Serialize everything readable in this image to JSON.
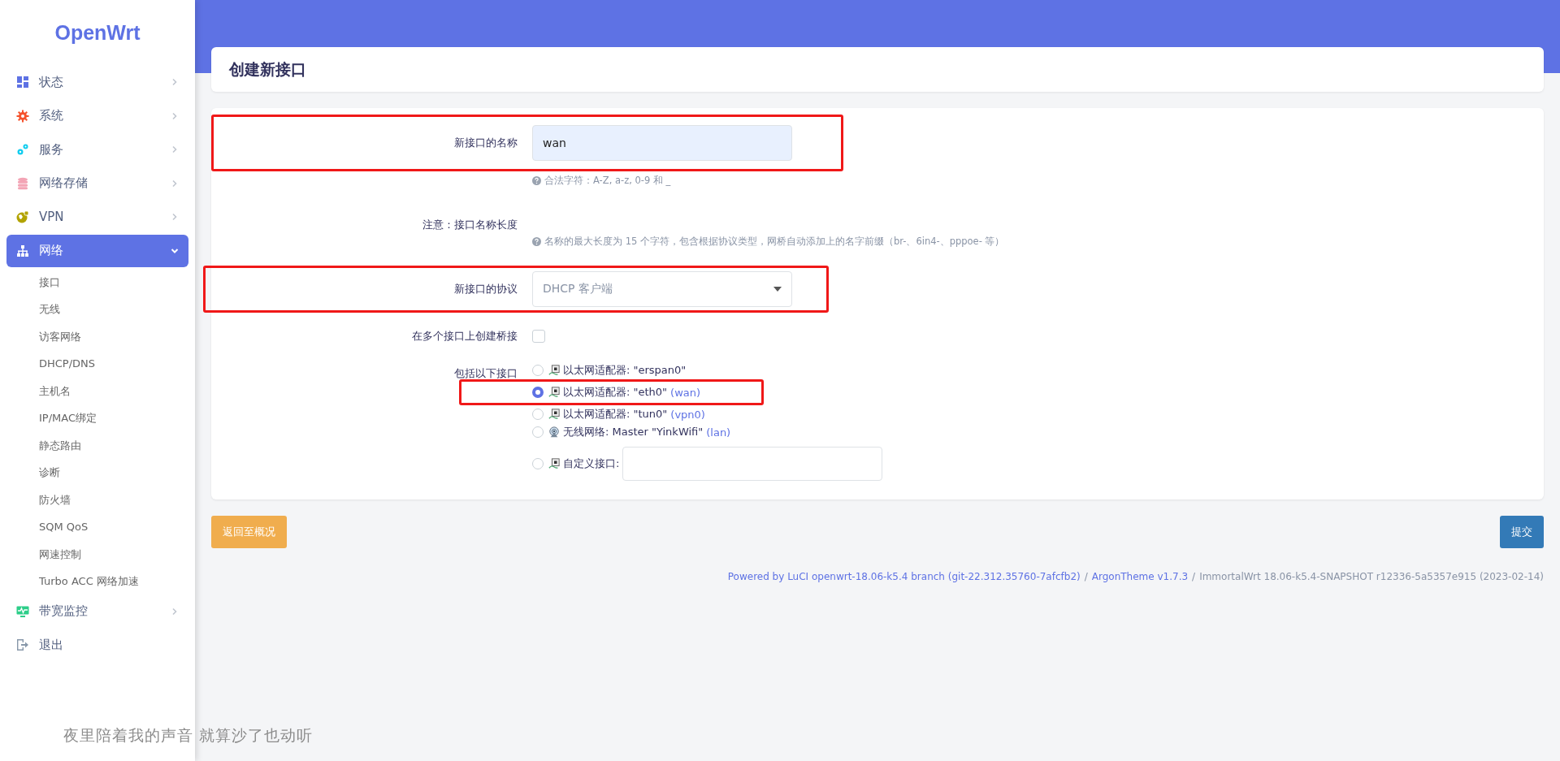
{
  "brand": "OpenWrt",
  "sidebar": {
    "items": [
      {
        "label": "状态",
        "expanded": false,
        "selected": false
      },
      {
        "label": "系统",
        "expanded": false,
        "selected": false
      },
      {
        "label": "服务",
        "expanded": false,
        "selected": false
      },
      {
        "label": "网络存储",
        "expanded": false,
        "selected": false
      },
      {
        "label": "VPN",
        "expanded": false,
        "selected": false
      },
      {
        "label": "网络",
        "expanded": true,
        "selected": true,
        "children": [
          {
            "label": "接口"
          },
          {
            "label": "无线"
          },
          {
            "label": "访客网络"
          },
          {
            "label": "DHCP/DNS"
          },
          {
            "label": "主机名"
          },
          {
            "label": "IP/MAC绑定"
          },
          {
            "label": "静态路由"
          },
          {
            "label": "诊断"
          },
          {
            "label": "防火墙"
          },
          {
            "label": "SQM QoS"
          },
          {
            "label": "网速控制"
          },
          {
            "label": "Turbo ACC 网络加速"
          }
        ]
      },
      {
        "label": "带宽监控",
        "expanded": false,
        "selected": false
      },
      {
        "label": "退出",
        "selected": false
      }
    ]
  },
  "page_title": "创建新接口",
  "form": {
    "name_field": {
      "label": "新接口的名称",
      "value": "wan",
      "hint": "合法字符：A-Z, a-z, 0-9 和 _",
      "highlighted": true
    },
    "note": {
      "label": "注意：接口名称长度",
      "hint": "名称的最大长度为 15 个字符，包含根据协议类型，网桥自动添加上的名字前缀（br-、6in4-、pppoe- 等）"
    },
    "protocol": {
      "label": "新接口的协议",
      "value": "DHCP 客户端",
      "highlighted": true
    },
    "bridge": {
      "label": "在多个接口上创建桥接",
      "checked": false
    },
    "interfaces": {
      "label": "包括以下接口",
      "options": [
        {
          "kind": "ethernet",
          "text": "以太网适配器: \"erspan0\"",
          "selected": false,
          "highlighted": false
        },
        {
          "kind": "ethernet",
          "text": "以太网适配器: \"eth0\"",
          "network": "(wan)",
          "selected": true,
          "highlighted": true
        },
        {
          "kind": "ethernet",
          "text": "以太网适配器: \"tun0\"",
          "network": "(vpn0)",
          "selected": false,
          "highlighted": false
        },
        {
          "kind": "wireless",
          "text": "无线网络: Master \"YinkWifi\"",
          "network": "(lan)",
          "selected": false,
          "highlighted": false
        },
        {
          "kind": "custom",
          "text": "自定义接口:",
          "selected": false,
          "highlighted": false
        }
      ]
    }
  },
  "buttons": {
    "back": "返回至概况",
    "submit": "提交"
  },
  "footer": {
    "separator": "/",
    "links": [
      "Powered by LuCI openwrt-18.06-k5.4 branch (git-22.312.35760-7afcfb2)",
      "ArgonTheme v1.7.3"
    ],
    "text": "ImmortalWrt 18.06-k5.4-SNAPSHOT r12336-5a5357e915 (2023-02-14)"
  },
  "lyric_overlay": "夜里陪着我的声音 就算沙了也动听"
}
